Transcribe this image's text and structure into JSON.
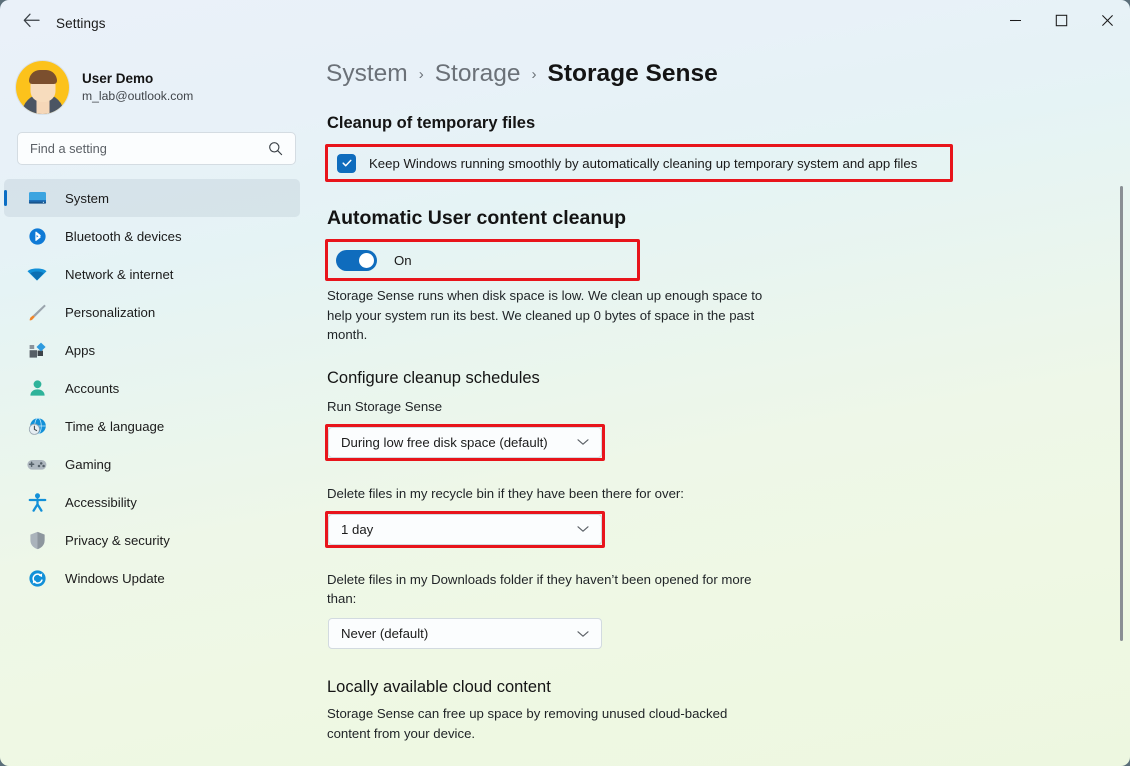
{
  "window": {
    "title": "Settings",
    "back_icon": "back-arrow-icon",
    "minimize_icon": "minimize-icon",
    "maximize_icon": "maximize-icon",
    "close_icon": "close-icon"
  },
  "accent_color": "#0f6cbd",
  "highlight_color": "#e8141b",
  "sidebar": {
    "account": {
      "name": "User Demo",
      "email": "m_lab@outlook.com",
      "avatar_icon": "avatar"
    },
    "search": {
      "placeholder": "Find a setting",
      "value": "",
      "icon": "search-icon"
    },
    "items": [
      {
        "label": "System",
        "icon": "monitor-icon",
        "active": true
      },
      {
        "label": "Bluetooth & devices",
        "icon": "bluetooth-icon",
        "active": false
      },
      {
        "label": "Network & internet",
        "icon": "wifi-icon",
        "active": false
      },
      {
        "label": "Personalization",
        "icon": "paintbrush-icon",
        "active": false
      },
      {
        "label": "Apps",
        "icon": "apps-icon",
        "active": false
      },
      {
        "label": "Accounts",
        "icon": "person-icon",
        "active": false
      },
      {
        "label": "Time & language",
        "icon": "clock-globe-icon",
        "active": false
      },
      {
        "label": "Gaming",
        "icon": "gamepad-icon",
        "active": false
      },
      {
        "label": "Accessibility",
        "icon": "accessibility-icon",
        "active": false
      },
      {
        "label": "Privacy & security",
        "icon": "shield-icon",
        "active": false
      },
      {
        "label": "Windows Update",
        "icon": "update-icon",
        "active": false
      }
    ]
  },
  "breadcrumb": {
    "root": "System",
    "parent": "Storage",
    "current": "Storage Sense",
    "separator": "›"
  },
  "main": {
    "temp_files_heading": "Cleanup of temporary files",
    "keep_windows_checkbox": {
      "label": "Keep Windows running smoothly by automatically cleaning up temporary system and app files",
      "checked": true,
      "highlighted": true
    },
    "auto_cleanup_heading": "Automatic User content cleanup",
    "storage_sense_toggle": {
      "label": "On",
      "state": "on",
      "highlighted": true
    },
    "storage_sense_description": "Storage Sense runs when disk space is low. We clean up enough space to help your system run its best. We cleaned up 0 bytes of space in the past month.",
    "configure_heading": "Configure cleanup schedules",
    "fields": [
      {
        "label": "Run Storage Sense",
        "value": "During low free disk space (default)",
        "highlighted": true,
        "chevron_icon": "chevron-down-icon"
      },
      {
        "label": "Delete files in my recycle bin if they have been there for over:",
        "value": "1 day",
        "highlighted": true,
        "chevron_icon": "chevron-down-icon"
      },
      {
        "label": "Delete files in my Downloads folder if they haven’t been opened for more than:",
        "value": "Never (default)",
        "highlighted": false,
        "chevron_icon": "chevron-down-icon"
      }
    ],
    "cloud_heading": "Locally available cloud content",
    "cloud_description": "Storage Sense can free up space by removing unused cloud-backed content from your device."
  }
}
